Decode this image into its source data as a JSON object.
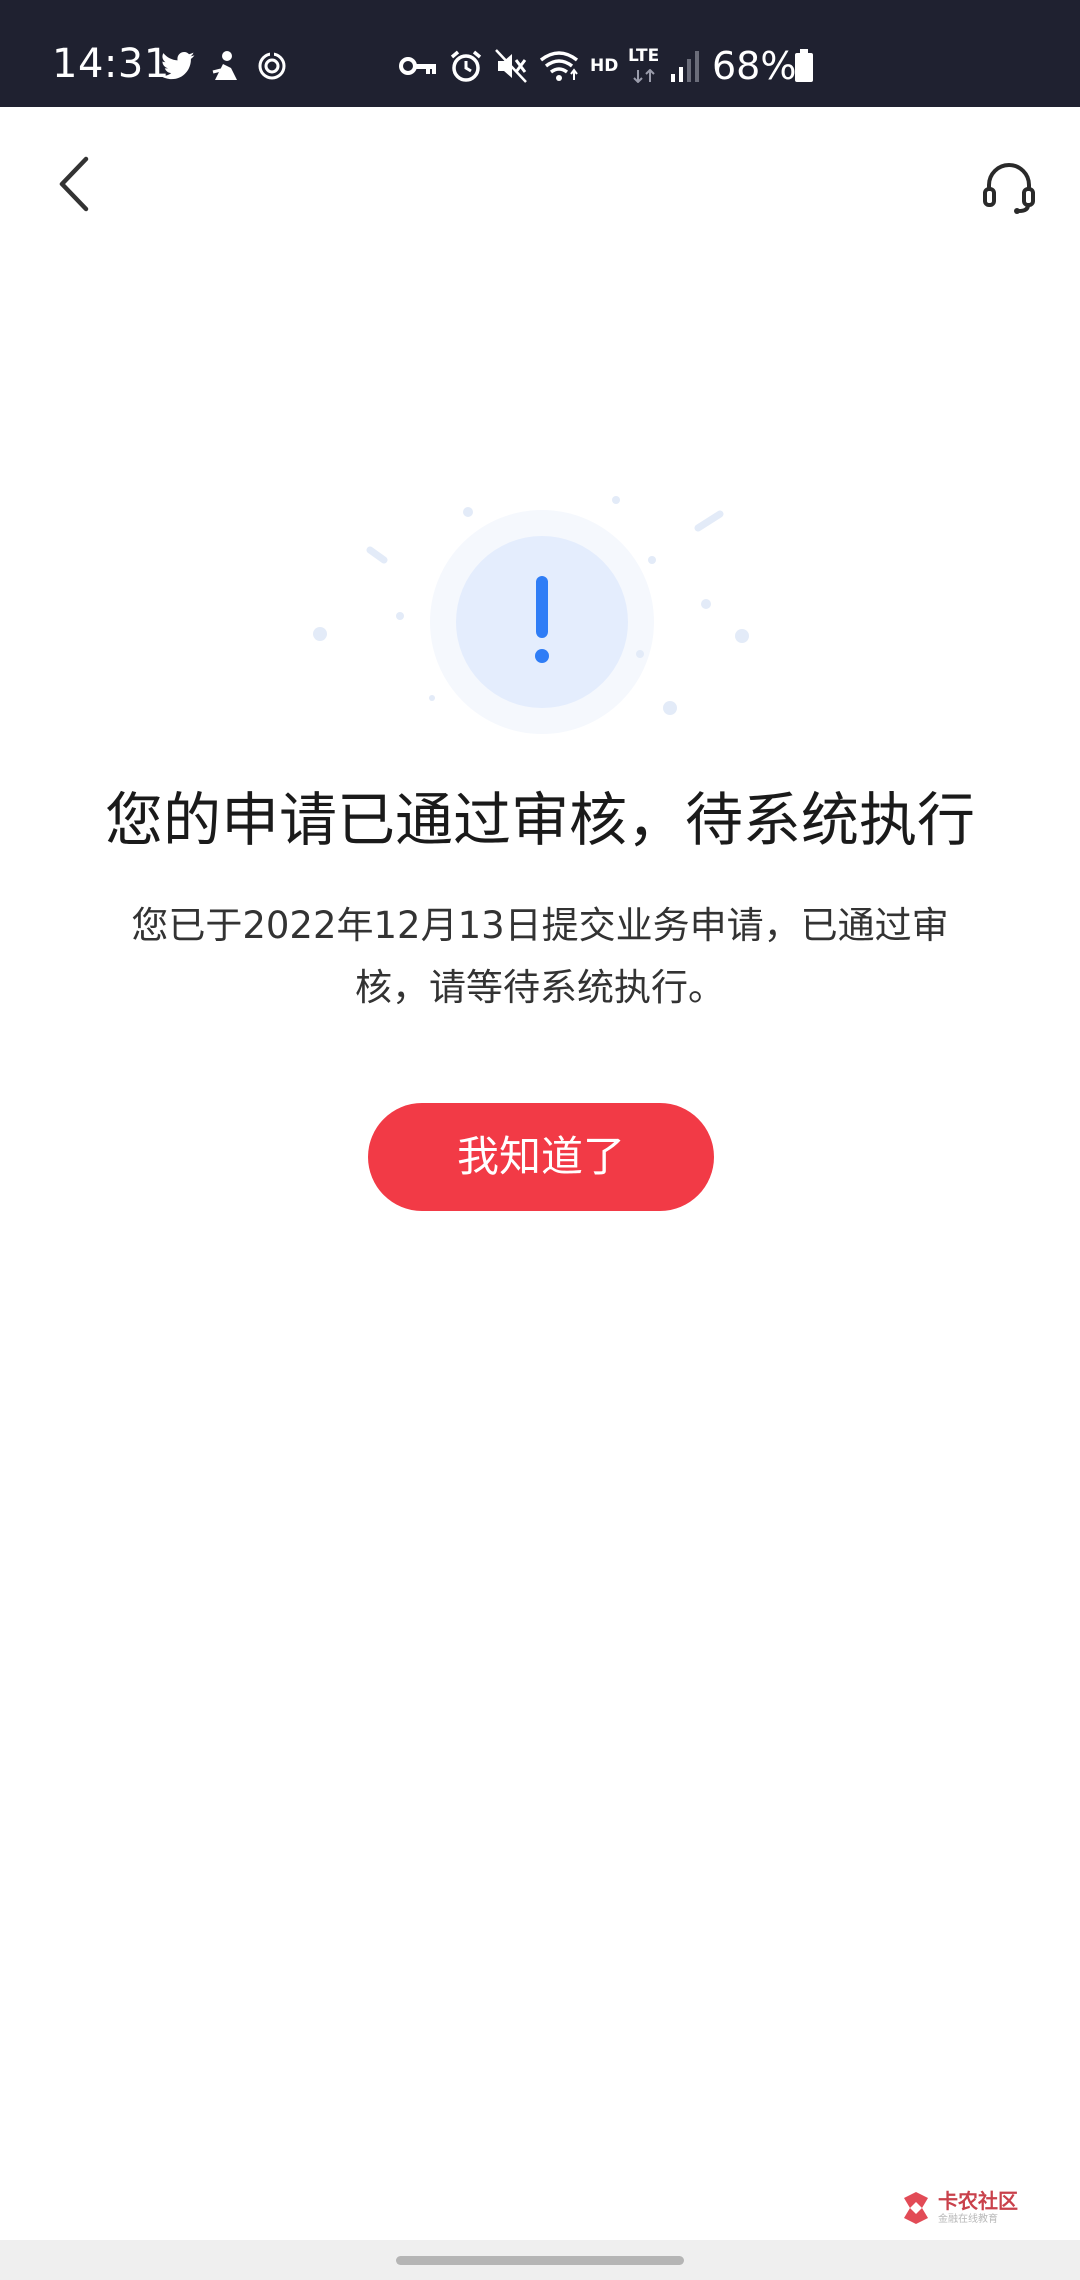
{
  "status_bar": {
    "time": "14:31",
    "hd": "HD",
    "lte": "LTE",
    "battery": "68%",
    "icons": [
      "twitter-icon",
      "app-notification-icon",
      "sync-icon",
      "vpn-key-icon",
      "alarm-icon",
      "mute-icon",
      "wifi-icon",
      "signal-icon",
      "battery-icon"
    ]
  },
  "nav": {
    "back_icon": "chevron-left-icon",
    "support_icon": "headset-icon"
  },
  "result": {
    "icon": "exclamation-icon",
    "title": "您的申请已通过审核，待系统执行",
    "description": "您已于2022年12月13日提交业务申请，已通过审核，请等待系统执行。",
    "button_label": "我知道了"
  },
  "watermark": {
    "title": "卡农社区",
    "subtitle": "金融在线教育"
  },
  "colors": {
    "status_bar_bg": "#1f2130",
    "accent_red": "#f23a46",
    "icon_blue": "#2f7df6",
    "icon_bg": "#e6efff"
  }
}
